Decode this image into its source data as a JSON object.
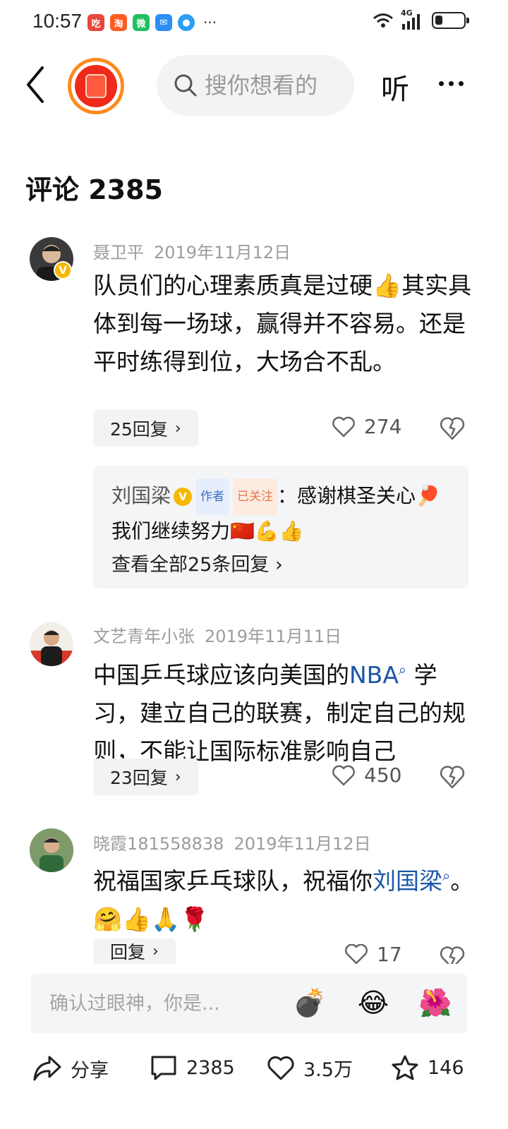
{
  "status_bar": {
    "time": "10:57",
    "app_icons": [
      "吃",
      "淘",
      "微",
      "✉",
      "●"
    ],
    "more": "···",
    "network": "4G",
    "battery_percent": 25
  },
  "top_bar": {
    "search_placeholder": "搜你想看的",
    "listen_label": "听"
  },
  "comments_header": {
    "title": "评论 2385"
  },
  "comments": [
    {
      "user": "聂卫平",
      "date": "2019年11月12日",
      "text": "队员们的心理素质真是过硬👍其实具体到每一场球，赢得并不容易。还是平时练得到位，大场合不乱。",
      "reply_label": "25回复",
      "likes": "274",
      "author_reply": {
        "name": "刘国梁",
        "author_tag": "作者",
        "follow_tag": "已关注",
        "text": "：感谢棋圣关心🏓我们继续努力🇨🇳💪👍",
        "view_all": "查看全部25条回复"
      }
    },
    {
      "user": "文艺青年小张",
      "date": "2019年11月11日",
      "text_before": "中国乒乓球应该向美国的",
      "link": "NBA",
      "text_after": " 学习，建立自己的联赛，制定自己的规则，不能让国际标准影响自己",
      "reply_label": "23回复",
      "likes": "450"
    },
    {
      "user": "晓霞181558838",
      "date": "2019年11月12日",
      "text_before": "祝福国家乒乓球队，祝福你",
      "link": "刘国梁",
      "text_after": "。🤗👍🙏🌹",
      "reply_label": "回复",
      "likes": "17"
    }
  ],
  "comment_input": {
    "placeholder": "确认过眼神，你是...",
    "quick_emojis": [
      "💣",
      "😂",
      "🌺"
    ]
  },
  "action_bar": {
    "share": "分享",
    "comments": "2385",
    "likes": "3.5万",
    "favorites": "146"
  }
}
